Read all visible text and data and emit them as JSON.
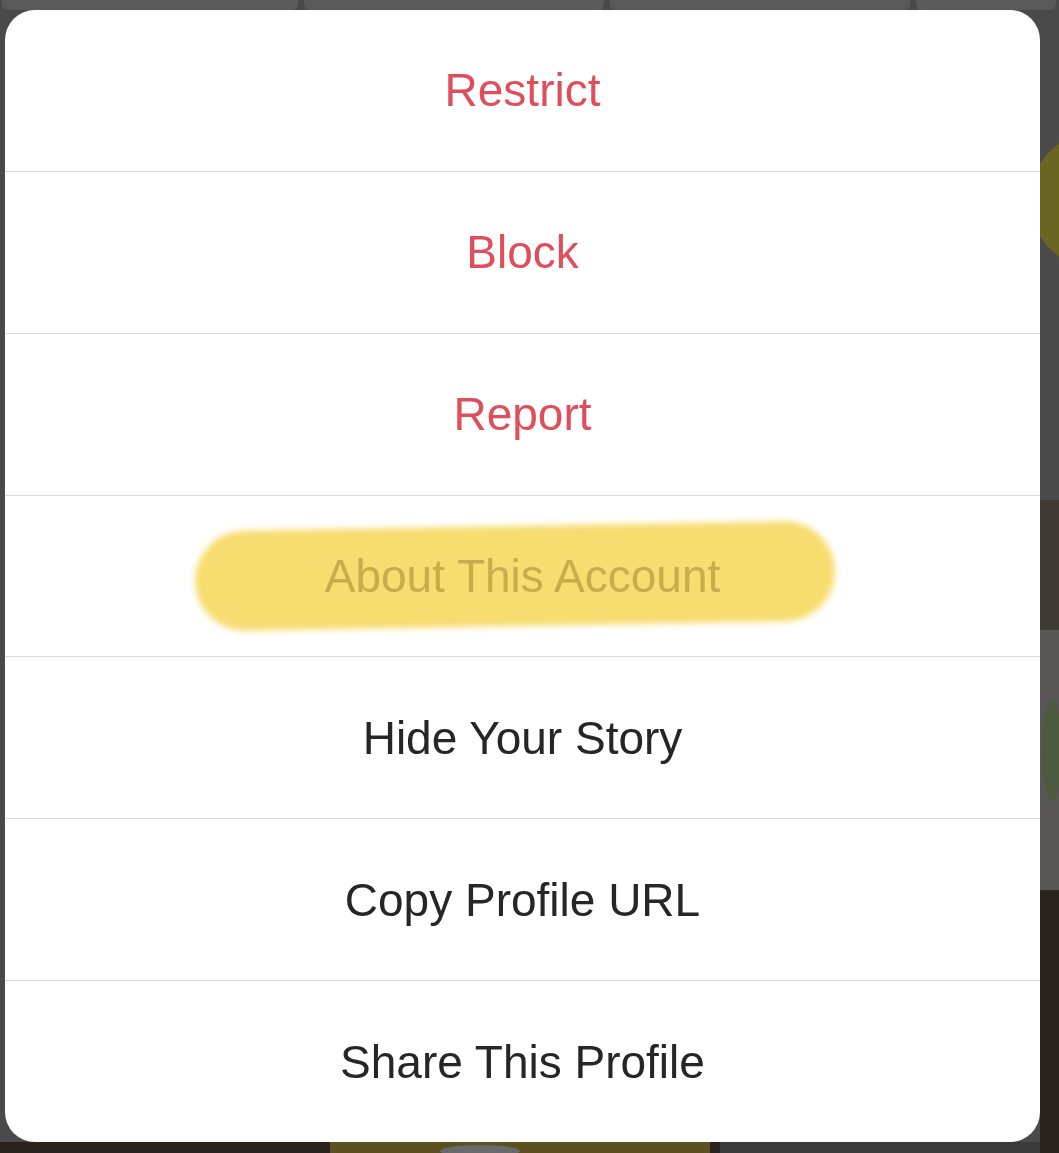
{
  "action_sheet": {
    "items": [
      {
        "label": "Restrict",
        "kind": "destructive",
        "highlighted": false
      },
      {
        "label": "Block",
        "kind": "destructive",
        "highlighted": false
      },
      {
        "label": "Report",
        "kind": "destructive",
        "highlighted": false
      },
      {
        "label": "About This Account",
        "kind": "default",
        "highlighted": true
      },
      {
        "label": "Hide Your Story",
        "kind": "default",
        "highlighted": false
      },
      {
        "label": "Copy Profile URL",
        "kind": "default",
        "highlighted": false
      },
      {
        "label": "Share This Profile",
        "kind": "default",
        "highlighted": false
      }
    ]
  }
}
